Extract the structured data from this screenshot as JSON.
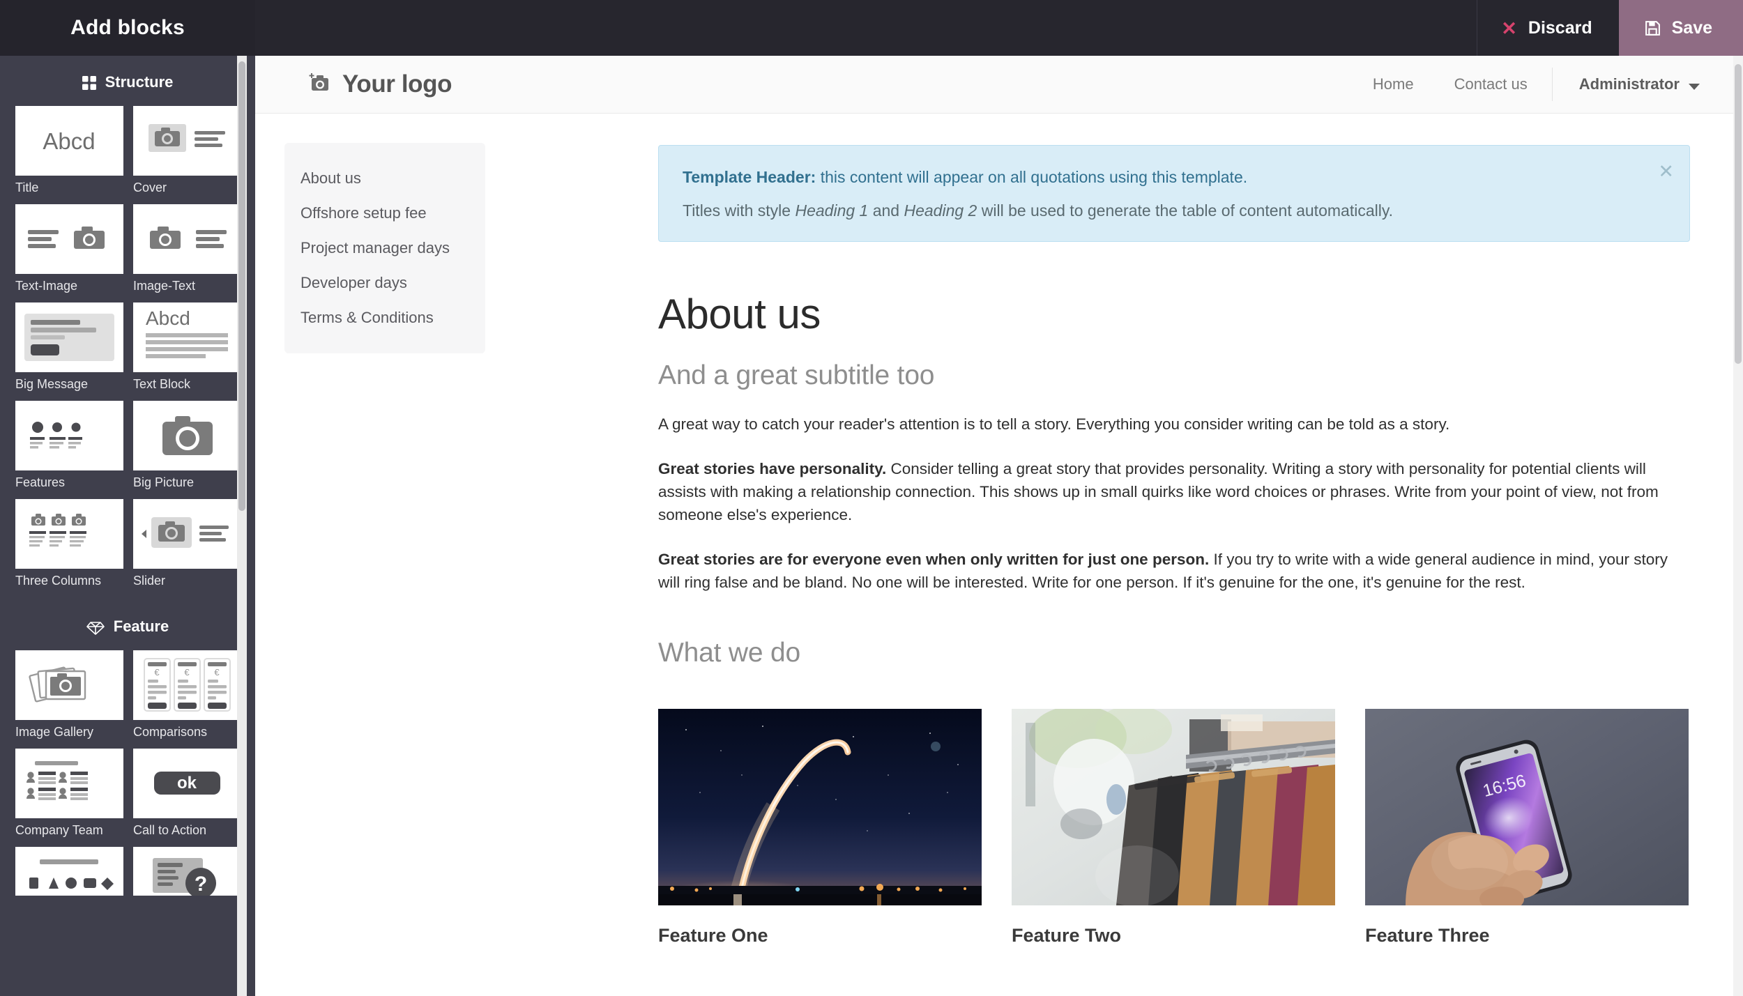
{
  "topbar": {
    "title": "Add blocks",
    "discard_label": "Discard",
    "save_label": "Save",
    "discard_icon": "close-x-icon",
    "save_icon": "floppy-disk-icon",
    "save_bg": "#8f6c84",
    "discard_icon_color": "#d6436d",
    "bg": "#27262e"
  },
  "sidebar": {
    "sections": [
      {
        "label": "Structure",
        "icon": "grid-icon",
        "blocks": [
          {
            "label": "Title",
            "thumb": "abcd-text-thumb"
          },
          {
            "label": "Cover",
            "thumb": "cover-camera-thumb"
          },
          {
            "label": "Text-Image",
            "thumb": "text-left-image-right-thumb"
          },
          {
            "label": "Image-Text",
            "thumb": "image-left-text-right-thumb"
          },
          {
            "label": "Big Message",
            "thumb": "big-message-thumb"
          },
          {
            "label": "Text Block",
            "thumb": "abcd-paragraph-thumb"
          },
          {
            "label": "Features",
            "thumb": "three-dots-features-thumb"
          },
          {
            "label": "Big Picture",
            "thumb": "big-camera-thumb"
          },
          {
            "label": "Three Columns",
            "thumb": "three-columns-thumb"
          },
          {
            "label": "Slider",
            "thumb": "slider-camera-thumb"
          }
        ]
      },
      {
        "label": "Feature",
        "icon": "gem-icon",
        "blocks": [
          {
            "label": "Image Gallery",
            "thumb": "photo-stack-thumb"
          },
          {
            "label": "Comparisons",
            "thumb": "pricing-cards-thumb"
          },
          {
            "label": "Company Team",
            "thumb": "team-members-thumb"
          },
          {
            "label": "Call to Action",
            "thumb": "ok-button-thumb"
          },
          {
            "label": "",
            "thumb": "icons-row-thumb"
          },
          {
            "label": "",
            "thumb": "faq-question-thumb"
          }
        ]
      }
    ]
  },
  "page_header": {
    "logo_text": "Your logo",
    "logo_icon": "add-photo-camera-icon",
    "nav": [
      {
        "label": "Home"
      },
      {
        "label": "Contact us"
      }
    ],
    "user": "Administrator",
    "user_caret_icon": "chevron-down-icon"
  },
  "alert": {
    "strong": "Template Header:",
    "line1_rest": " this content will appear on all quotations using this template.",
    "line2_a": "Titles with style ",
    "line2_em1": "Heading 1",
    "line2_b": " and ",
    "line2_em2": "Heading 2",
    "line2_c": " will be used to generate the table of content automatically.",
    "close_icon": "close-x-icon",
    "bg": "#d9edf7",
    "text_color": "#31708f"
  },
  "toc": {
    "items": [
      {
        "label": "About us"
      },
      {
        "label": "Offshore setup fee"
      },
      {
        "label": "Project manager days"
      },
      {
        "label": "Developer days"
      },
      {
        "label": "Terms & Conditions"
      }
    ]
  },
  "article": {
    "title": "About us",
    "subtitle": "And a great subtitle too",
    "p1": "A great way to catch your reader's attention is to tell a story. Everything you consider writing can be told as a story.",
    "p2_bold": "Great stories have personality.",
    "p2_rest": " Consider telling a great story that provides personality. Writing a story with personality for potential clients will assists with making a relationship connection. This shows up in small quirks like word choices or phrases. Write from your point of view, not from someone else's experience.",
    "p3_bold": "Great stories are for everyone even when only written for just one person.",
    "p3_rest": " If you try to write with a wide general audience in mind, your story will ring false and be bland. No one will be interested. Write for one person. If it's genuine for the one, it's genuine for the rest.",
    "section_heading": "What we do",
    "features": [
      {
        "caption": "Feature One",
        "image": "rocket-launch-night-photo"
      },
      {
        "caption": "Feature Two",
        "image": "clothing-rack-hangers-photo"
      },
      {
        "caption": "Feature Three",
        "image": "hand-holding-smartphone-photo"
      }
    ]
  }
}
